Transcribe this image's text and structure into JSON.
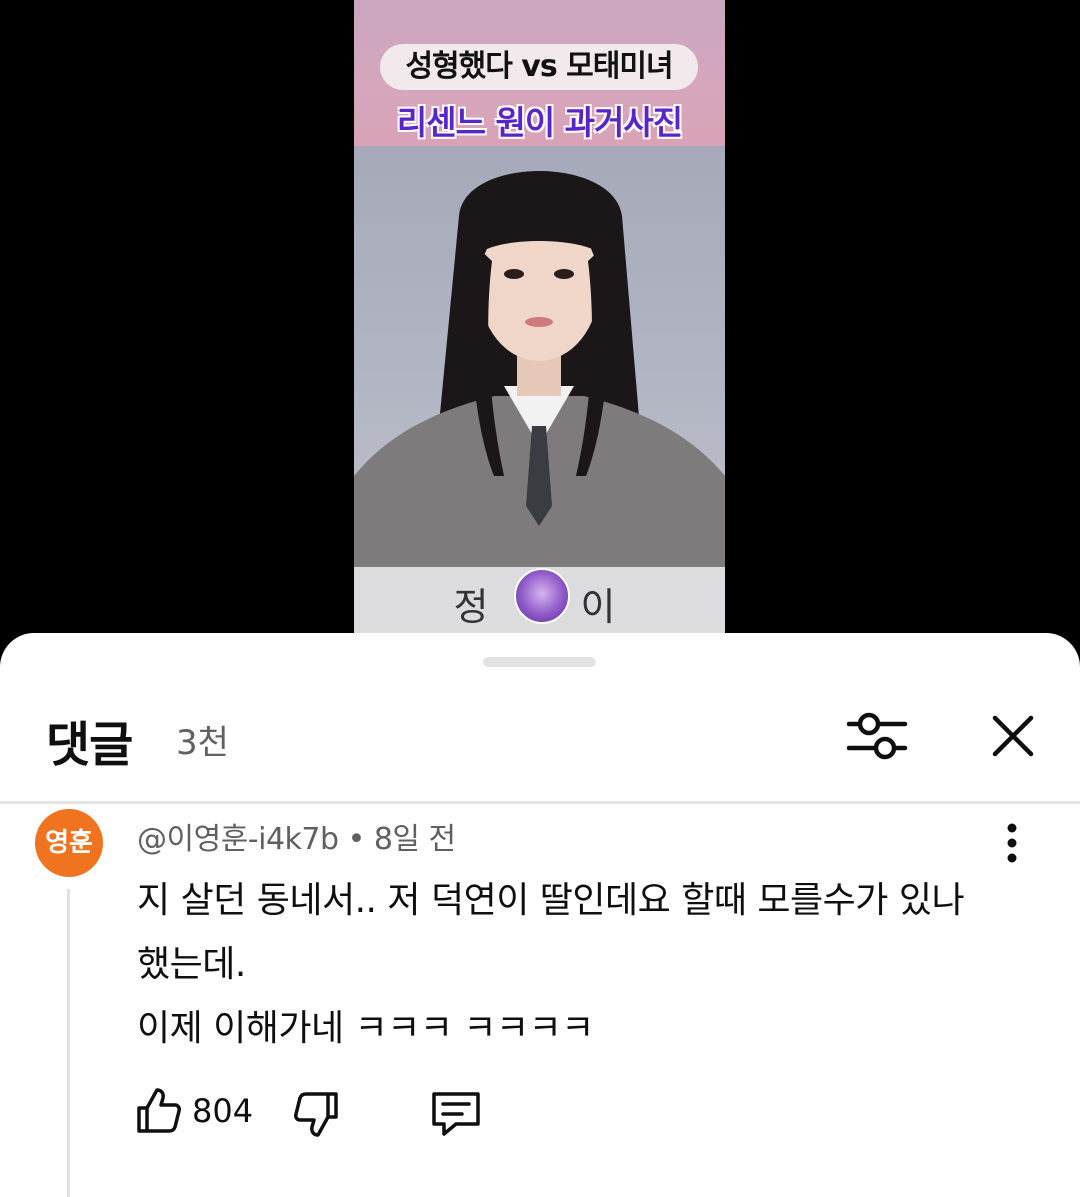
{
  "video": {
    "title_line1": "성형했다 vs 모태미녀",
    "title_line2": "리센느 원이 과거사진",
    "name_plate": "정 이"
  },
  "comments_panel": {
    "title": "댓글",
    "count": "3천"
  },
  "comment": {
    "avatar_text": "영훈",
    "author_meta": "@이영훈-i4k7b • 8일 전",
    "body_lines": [
      "지 살던 동네서.. 저 덕연이 딸인데요 할때 모를수가 있나",
      "했는데.",
      " 이제 이해가네 ㅋㅋㅋ ㅋㅋㅋㅋ"
    ],
    "like_count": "804"
  },
  "colors": {
    "avatar_bg": "#f07320",
    "subtitle_purple": "#5a24c9",
    "header_pink": "#d6a6bd"
  }
}
